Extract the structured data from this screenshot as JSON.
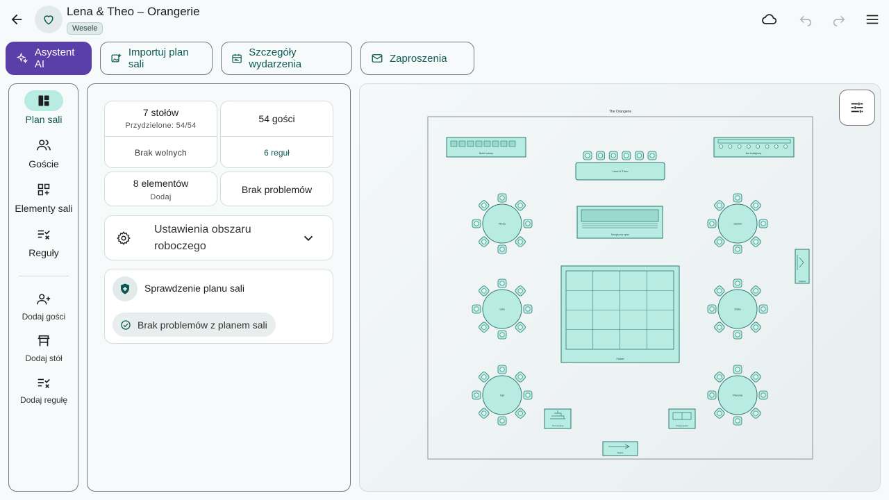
{
  "header": {
    "title": "Lena & Theo – Orangerie",
    "badge": "Wesele"
  },
  "actions": {
    "ai": "Asystent AI",
    "import": "Importuj plan sali",
    "details": "Szczegóły wydarzenia",
    "invites": "Zaproszenia"
  },
  "nav": {
    "items": [
      {
        "label": "Plan sali",
        "icon": "layout-icon"
      },
      {
        "label": "Goście",
        "icon": "guests-icon"
      },
      {
        "label": "Elementy sali",
        "icon": "elements-icon"
      },
      {
        "label": "Reguły",
        "icon": "rules-icon"
      }
    ],
    "actions": [
      {
        "label": "Dodaj gości",
        "icon": "add-person-icon"
      },
      {
        "label": "Dodaj stół",
        "icon": "table-icon"
      },
      {
        "label": "Dodaj regułę",
        "icon": "add-rule-icon"
      }
    ]
  },
  "stats": {
    "tables": "7 stołów",
    "assigned": "Przydzielone: 54/54",
    "free": "Brak wolnych",
    "guests": "54 gości",
    "rules": "6 reguł",
    "elements": "8 elementów",
    "elements_sub": "Dodaj",
    "problems": "Brak problemów"
  },
  "workspace": {
    "label": "Ustawienia obszaru roboczego"
  },
  "check": {
    "title": "Sprawdzenie planu sali",
    "status": "Brak problemów z planem sali"
  },
  "floor": {
    "venue": "The Orangerie",
    "head_table": "Lena & Theo",
    "bar_left": "Bufet lodowy",
    "bar_right": "Bar koktajlowy",
    "music": "Muzyka na żywo",
    "dance": "Parkiet",
    "exit": "Wyjście",
    "cake": "Tort weselny",
    "gifts": "Księga gości",
    "entrance": "Wejście",
    "tables": [
      "Róża",
      "Jaśmin",
      "Lilia",
      "Dalia",
      "Iryś",
      "Piwonia"
    ]
  },
  "colors": {
    "accent": "#0c5a52",
    "primary": "#5a3fa8",
    "table_fill": "#b8ece2",
    "table_stroke": "#2a7a70"
  }
}
